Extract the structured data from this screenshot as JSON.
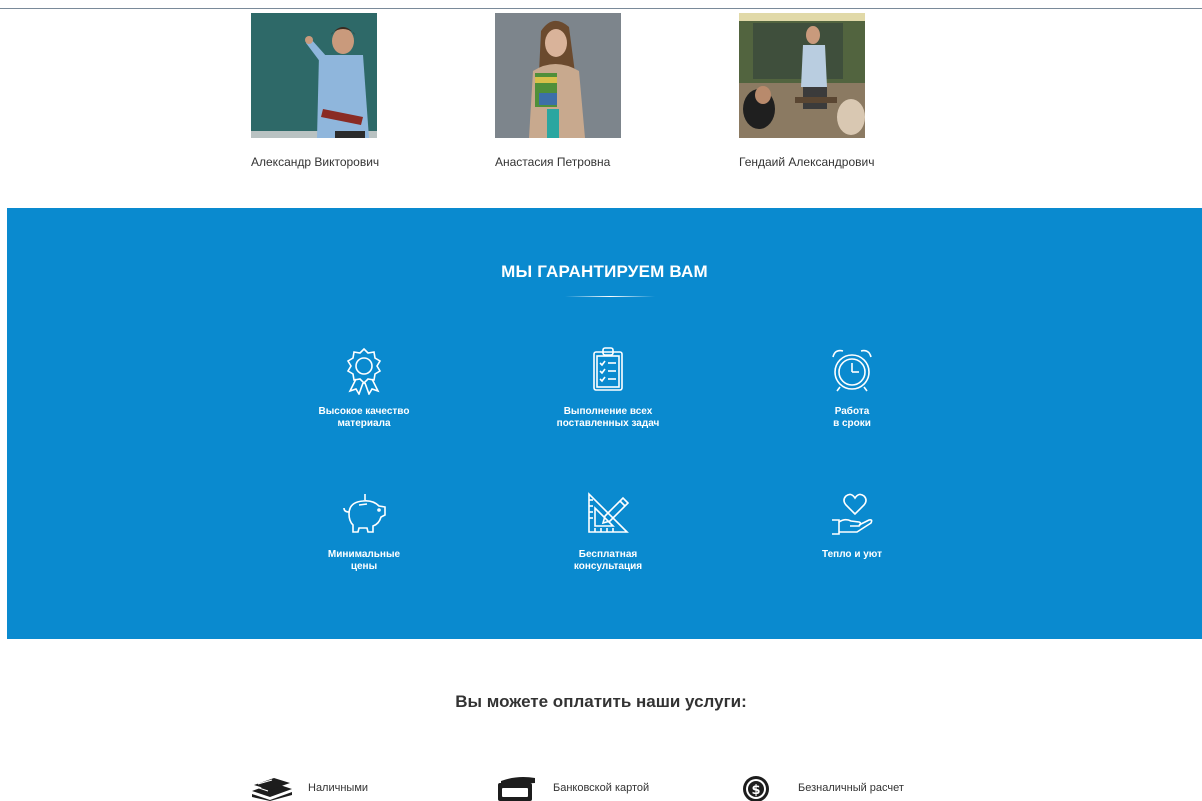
{
  "teachers": [
    {
      "name": "Александр Викторович",
      "photo_icon": "teacher-at-blackboard-photo"
    },
    {
      "name": "Анастасия Петровна",
      "photo_icon": "teacher-holding-books-photo"
    },
    {
      "name": "Гендаий Александрович",
      "photo_icon": "teacher-in-classroom-photo"
    }
  ],
  "guarantee": {
    "title": "МЫ ГАРАНТИРУЕМ ВАМ",
    "background": "#0a8acf",
    "features": [
      {
        "label": "Высокое качество\nматериала",
        "icon": "award-badge-icon"
      },
      {
        "label": "Выполнение всех\nпоставленных задач",
        "icon": "checklist-clipboard-icon"
      },
      {
        "label": "Работа\nв сроки",
        "icon": "alarm-clock-icon"
      },
      {
        "label": "Минимальные\nцены",
        "icon": "piggy-bank-icon"
      },
      {
        "label": "Бесплатная\nконсультация",
        "icon": "ruler-pencil-icon"
      },
      {
        "label": "Тепло и уют",
        "icon": "hand-heart-icon"
      }
    ]
  },
  "payment": {
    "title": "Вы можете оплатить наши услуги:",
    "methods": [
      {
        "label": "Наличными",
        "icon": "cash-stack-icon"
      },
      {
        "label": "Банковской картой",
        "icon": "bank-card-icon"
      },
      {
        "label": "Безналичный расчет",
        "icon": "dollar-coin-icon"
      }
    ]
  }
}
